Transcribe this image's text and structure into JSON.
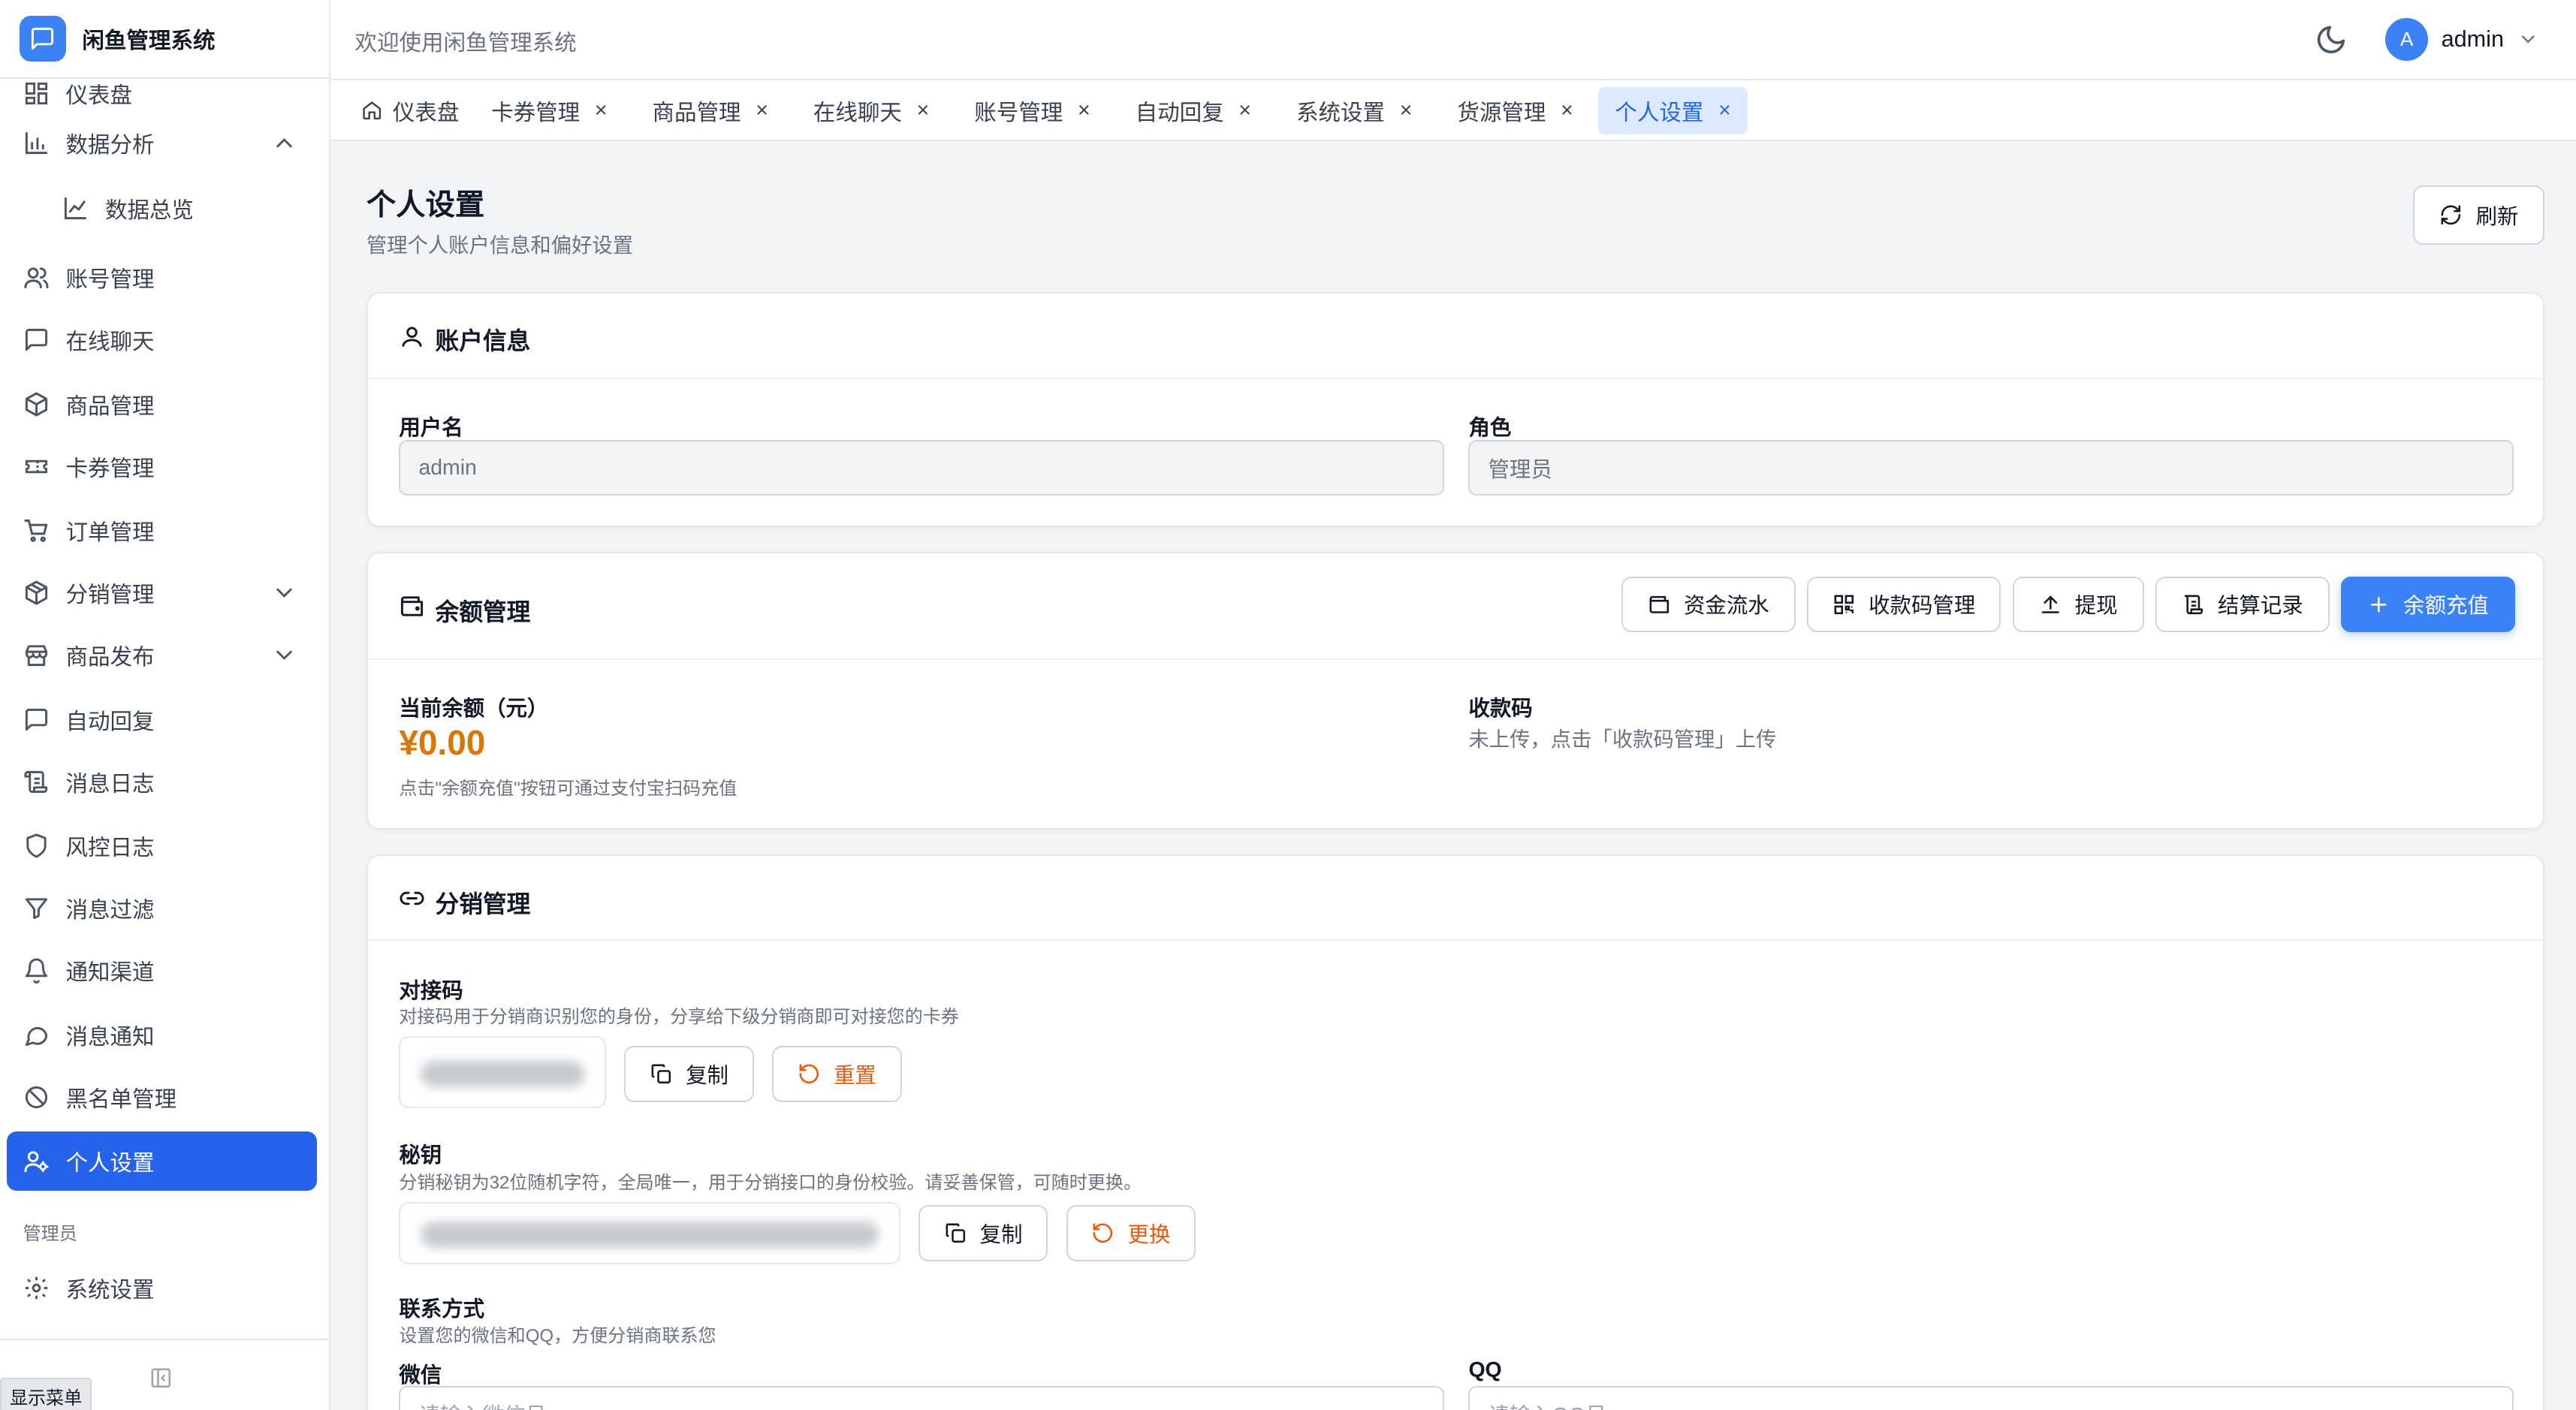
{
  "app": {
    "title": "闲鱼管理系统"
  },
  "header": {
    "welcome": "欢迎使用闲鱼管理系统",
    "user_initial": "A",
    "user_name": "admin"
  },
  "sidebar": {
    "items": [
      {
        "label": "仪表盘",
        "icon": "dashboard-icon"
      },
      {
        "label": "数据分析",
        "icon": "bar-chart-icon",
        "expanded": true
      },
      {
        "label": "数据总览",
        "icon": "line-chart-icon",
        "sub": true
      },
      {
        "label": "账号管理",
        "icon": "users-icon"
      },
      {
        "label": "在线聊天",
        "icon": "chat-icon"
      },
      {
        "label": "商品管理",
        "icon": "package-icon"
      },
      {
        "label": "卡券管理",
        "icon": "ticket-icon"
      },
      {
        "label": "订单管理",
        "icon": "cart-icon"
      },
      {
        "label": "分销管理",
        "icon": "distribution-icon",
        "expandable": true
      },
      {
        "label": "商品发布",
        "icon": "store-icon",
        "expandable": true
      },
      {
        "label": "自动回复",
        "icon": "message-icon"
      },
      {
        "label": "消息日志",
        "icon": "scroll-icon"
      },
      {
        "label": "风控日志",
        "icon": "shield-icon"
      },
      {
        "label": "消息过滤",
        "icon": "filter-icon"
      },
      {
        "label": "通知渠道",
        "icon": "bell-icon"
      },
      {
        "label": "消息通知",
        "icon": "message-circle-icon"
      },
      {
        "label": "黑名单管理",
        "icon": "ban-icon"
      },
      {
        "label": "个人设置",
        "icon": "user-cog-icon",
        "active": true
      }
    ],
    "admin_section": "管理员",
    "admin_items": [
      {
        "label": "系统设置",
        "icon": "gear-icon"
      }
    ],
    "show_menu": "显示菜单"
  },
  "tabs": [
    {
      "label": "仪表盘",
      "closable": false
    },
    {
      "label": "卡券管理",
      "closable": true
    },
    {
      "label": "商品管理",
      "closable": true
    },
    {
      "label": "在线聊天",
      "closable": true
    },
    {
      "label": "账号管理",
      "closable": true
    },
    {
      "label": "自动回复",
      "closable": true
    },
    {
      "label": "系统设置",
      "closable": true
    },
    {
      "label": "货源管理",
      "closable": true
    },
    {
      "label": "个人设置",
      "closable": true,
      "active": true
    }
  ],
  "tab_close_glyph": "×",
  "page": {
    "title": "个人设置",
    "subtitle": "管理个人账户信息和偏好设置",
    "refresh_label": "刷新"
  },
  "account": {
    "title": "账户信息",
    "username_label": "用户名",
    "username_value": "admin",
    "role_label": "角色",
    "role_value": "管理员"
  },
  "balance": {
    "title": "余额管理",
    "buttons": {
      "flow": "资金流水",
      "qrcode": "收款码管理",
      "withdraw": "提现",
      "settle": "结算记录",
      "recharge": "余额充值"
    },
    "current_label": "当前余额（元）",
    "current_value": "¥0.00",
    "current_hint": "点击\"余额充值\"按钮可通过支付宝扫码充值",
    "qr_label": "收款码",
    "qr_status": "未上传，点击「收款码管理」上传"
  },
  "distribution": {
    "title": "分销管理",
    "code_label": "对接码",
    "code_hint": "对接码用于分销商识别您的身份，分享给下级分销商即可对接您的卡券",
    "copy_label": "复制",
    "reset_label": "重置",
    "secret_label": "秘钥",
    "secret_hint": "分销秘钥为32位随机字符，全局唯一，用于分销接口的身份校验。请妥善保管，可随时更换。",
    "replace_label": "更换",
    "contact_label": "联系方式",
    "contact_hint": "设置您的微信和QQ，方便分销商联系您",
    "wechat_label": "微信",
    "wechat_placeholder": "请输入微信号",
    "qq_label": "QQ",
    "qq_placeholder": "请输入QQ号"
  },
  "colors": {
    "primary": "#3b82f6",
    "active_nav": "#2563eb",
    "balance": "#d97706",
    "warn": "#ea580c"
  }
}
